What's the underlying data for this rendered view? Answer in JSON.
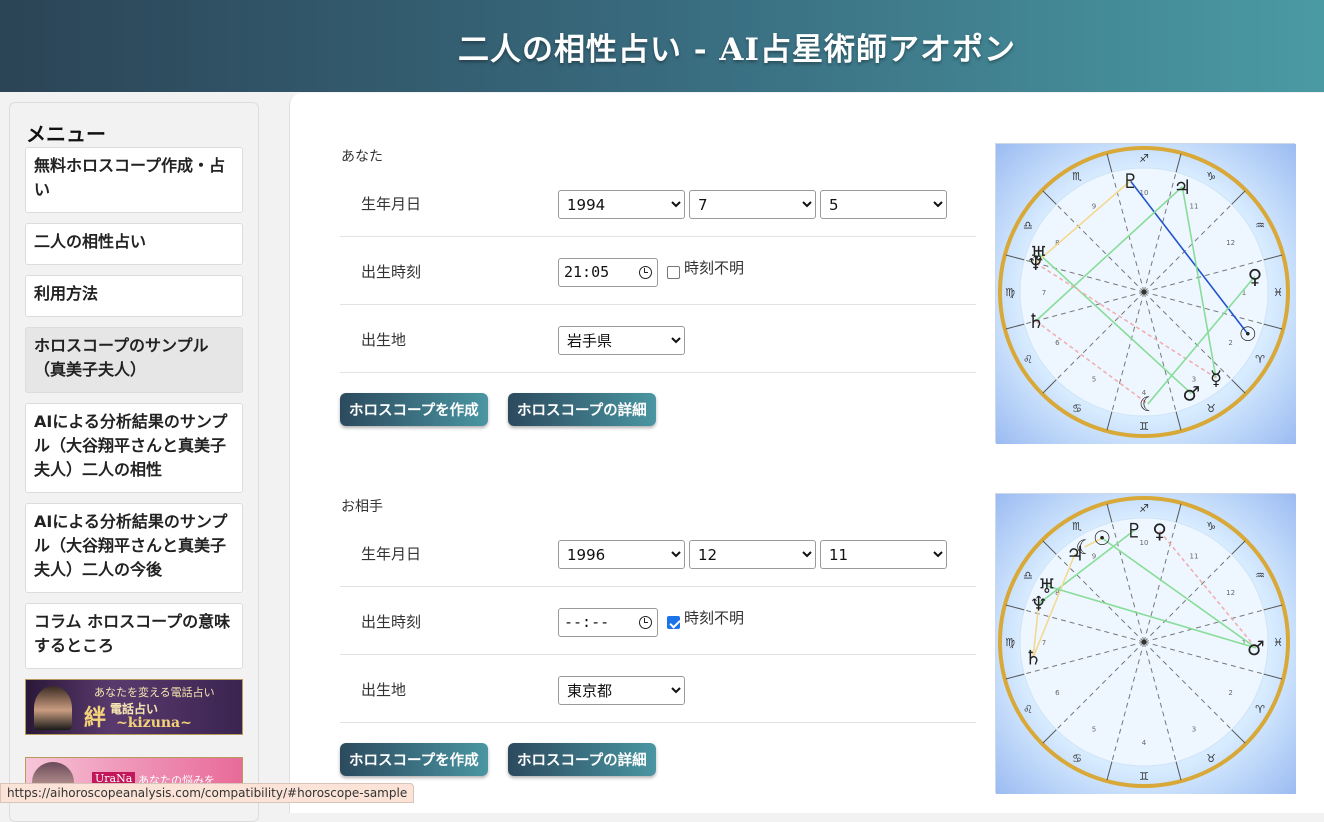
{
  "header": {
    "title": "二人の相性占い - AI占星術師アオポン"
  },
  "sidebar": {
    "title": "メニュー",
    "items": [
      {
        "label": "無料ホロスコープ作成・占い"
      },
      {
        "label": "二人の相性占い"
      },
      {
        "label": "利用方法"
      },
      {
        "label": "ホロスコープのサンプル（真美子夫人）"
      },
      {
        "label": "AIによる分析結果のサンプル（大谷翔平さんと真美子夫人）二人の相性"
      },
      {
        "label": "AIによる分析結果のサンプル（大谷翔平さんと真美子夫人）二人の今後"
      },
      {
        "label": "コラム ホロスコープの意味するところ"
      }
    ],
    "banners": [
      {
        "text1": "あなたを変える電話占い",
        "text2": "絆",
        "text3": "電話占い",
        "text4": "~kizuna~"
      },
      {
        "text1": "UraNa",
        "text2": "あなたの悩みを"
      }
    ]
  },
  "labels": {
    "birthdate": "生年月日",
    "birthtime": "出生時刻",
    "birthplace": "出生地",
    "unknown_time": "時刻不明",
    "create_button": "ホロスコープを作成",
    "detail_button": "ホロスコープの詳細"
  },
  "you": {
    "heading": "あなた",
    "year": "1994",
    "month": "7",
    "day": "5",
    "time": "21:05",
    "time_unknown": false,
    "place": "岩手県"
  },
  "partner": {
    "heading": "お相手",
    "year": "1996",
    "month": "12",
    "day": "11",
    "time": "--:--",
    "time_unknown": true,
    "place": "東京都"
  },
  "status_bar": {
    "url": "https://aihoroscopeanalysis.com/compatibility/#horoscope-sample"
  },
  "colors": {
    "header_start": "#2b4456",
    "header_end": "#4a9aa4",
    "button_start": "#2c4a5e",
    "button_end": "#4a96a2",
    "chart_ring": "#d8a838"
  },
  "charts": [
    {
      "signs": [
        "♐",
        "♏",
        "♎",
        "♍",
        "♌",
        "♋",
        "♊",
        "♉",
        "♈",
        "♓",
        "♒",
        "♑"
      ],
      "planets": [
        "♇",
        "♃",
        "♅",
        "♆",
        "♄",
        "♀",
        "☉",
        "♂",
        "☿",
        "☾"
      ],
      "house_numbers": [
        "10",
        "9",
        "8",
        "7",
        "6",
        "5",
        "4",
        "3",
        "2",
        "1",
        "12",
        "11"
      ]
    },
    {
      "signs": [
        "♐",
        "♏",
        "♎",
        "♍",
        "♌",
        "♋",
        "♊",
        "♉",
        "♈",
        "♓",
        "♒",
        "♑"
      ],
      "planets": [
        "☉",
        "♇",
        "♀",
        "♃",
        "♅",
        "☾",
        "♆",
        "♄",
        "♂"
      ],
      "house_numbers": [
        "10",
        "9",
        "8",
        "7",
        "6",
        "5",
        "4",
        "3",
        "2",
        "1",
        "12",
        "11"
      ]
    }
  ]
}
